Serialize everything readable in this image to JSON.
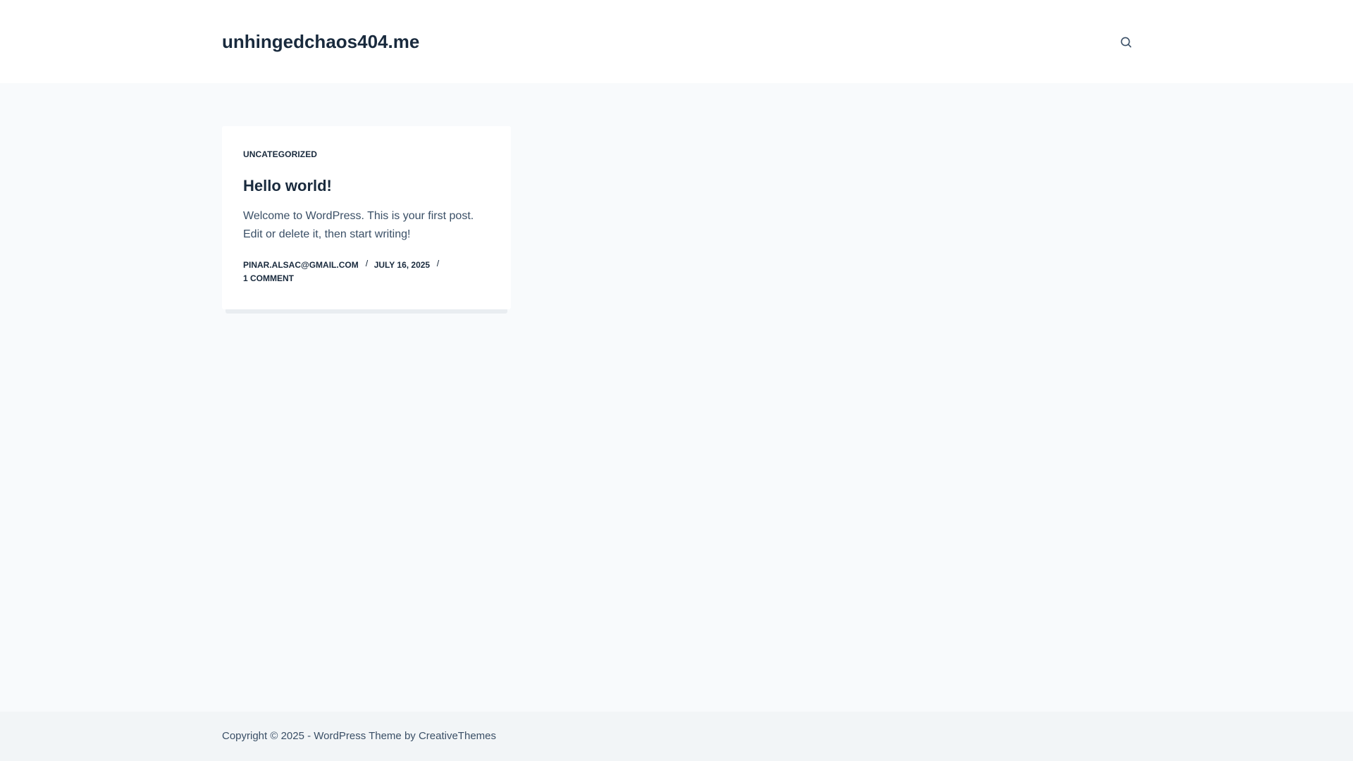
{
  "site": {
    "title": "unhingedchaos404.me"
  },
  "header": {
    "search_icon": "search-icon"
  },
  "post": {
    "category": "UNCATEGORIZED",
    "title": "Hello world!",
    "excerpt": "Welcome to WordPress. This is your first post. Edit or delete it, then start writing!",
    "author": "PINAR.ALSAC@GMAIL.COM",
    "date": "JULY 16, 2025",
    "comments": "1 COMMENT"
  },
  "footer": {
    "copyright_prefix": "Copyright © 2025 - WordPress Theme by ",
    "theme_author": "CreativeThemes"
  },
  "colors": {
    "heading": "#192a3d",
    "text": "#3a4f66",
    "page_bg": "#f8fafc",
    "footer_bg": "#f2f5f7"
  }
}
